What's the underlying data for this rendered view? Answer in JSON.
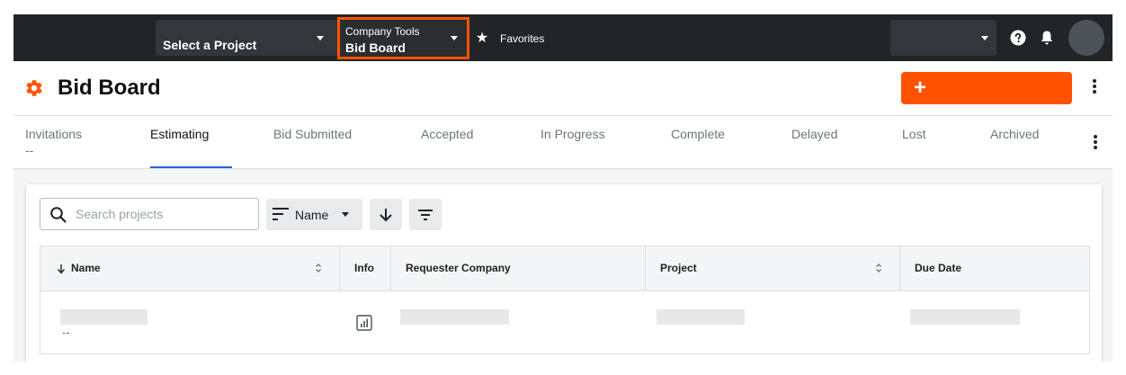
{
  "topnav": {
    "project_select_label": "Select a Project",
    "tool_select_sublabel": "Company Tools",
    "tool_select_label": "Bid Board",
    "favorites_label": "Favorites"
  },
  "header": {
    "title": "Bid Board",
    "create_button_label": "+"
  },
  "tabs": [
    {
      "label": "Invitations",
      "sublabel": "--"
    },
    {
      "label": "Estimating",
      "active": true
    },
    {
      "label": "Bid Submitted"
    },
    {
      "label": "Accepted"
    },
    {
      "label": "In Progress"
    },
    {
      "label": "Complete"
    },
    {
      "label": "Delayed"
    },
    {
      "label": "Lost"
    },
    {
      "label": "Archived"
    }
  ],
  "toolbar": {
    "search_placeholder": "Search projects",
    "sort_label": "Name"
  },
  "table": {
    "columns": [
      "Name",
      "Info",
      "Requester Company",
      "Project",
      "Due Date"
    ],
    "rows": [
      {
        "name_sub": "--"
      }
    ]
  },
  "colors": {
    "brand_orange": "#ff5200",
    "nav_bg": "#222528",
    "active_tab_underline": "#2066df"
  }
}
